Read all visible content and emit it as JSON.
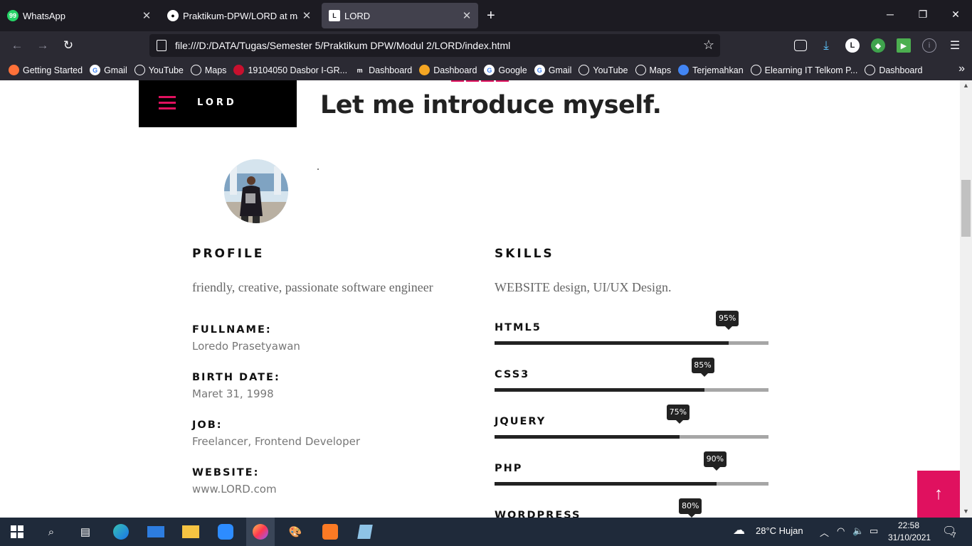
{
  "tabs": [
    {
      "label": "WhatsApp",
      "icon": "whatsapp-icon",
      "badge": "99+",
      "color": "#25d366"
    },
    {
      "label": "Praktikum-DPW/LORD at main",
      "icon": "github-icon"
    },
    {
      "label": "LORD",
      "icon": "lord-favicon"
    }
  ],
  "address": {
    "url": "file:///D:/DATA/Tugas/Semester 5/Praktikum DPW/Modul 2/LORD/index.html"
  },
  "toolbar": {
    "account_initial": "L"
  },
  "bookmarks": [
    {
      "label": "Getting Started",
      "icon": "firefox-icon"
    },
    {
      "label": "Gmail",
      "icon": "google-icon"
    },
    {
      "label": "YouTube",
      "icon": "globe-icon"
    },
    {
      "label": "Maps",
      "icon": "globe-icon"
    },
    {
      "label": "19104050 Dasbor I-GR...",
      "icon": "igracias-icon"
    },
    {
      "label": "Dashboard",
      "icon": "moodle-icon"
    },
    {
      "label": "Dashboard",
      "icon": "dashboard-icon"
    },
    {
      "label": "Google",
      "icon": "google-icon"
    },
    {
      "label": "Gmail",
      "icon": "google-icon"
    },
    {
      "label": "YouTube",
      "icon": "globe-icon"
    },
    {
      "label": "Maps",
      "icon": "globe-icon"
    },
    {
      "label": "Terjemahkan",
      "icon": "translate-icon"
    },
    {
      "label": "Elearning IT Telkom P...",
      "icon": "globe-icon"
    },
    {
      "label": "Dashboard",
      "icon": "globe-icon"
    }
  ],
  "site": {
    "logo": "LORD",
    "headline": "Let me introduce myself."
  },
  "profile": {
    "heading": "PROFILE",
    "summary": "friendly, creative, passionate software engineer",
    "fields": [
      {
        "label": "FULLNAME:",
        "value": "Loredo Prasetyawan"
      },
      {
        "label": "BIRTH DATE:",
        "value": "Maret 31, 1998"
      },
      {
        "label": "JOB:",
        "value": "Freelancer, Frontend Developer"
      },
      {
        "label": "WEBSITE:",
        "value": "www.LORD.com"
      }
    ]
  },
  "skills": {
    "heading": "SKILLS",
    "summary": "WEBSITE design, UI/UX Design.",
    "items": [
      {
        "name": "HTML5",
        "percent": 95,
        "label": "95%"
      },
      {
        "name": "CSS3",
        "percent": 85,
        "label": "85%"
      },
      {
        "name": "JQUERY",
        "percent": 75,
        "label": "75%"
      },
      {
        "name": "PHP",
        "percent": 90,
        "label": "90%"
      },
      {
        "name": "WORDPRESS",
        "percent": 80,
        "label": "80%"
      }
    ]
  },
  "colors": {
    "accent": "#e0115f",
    "chrome_dark": "#1c1b22",
    "chrome": "#2b2a33"
  },
  "taskbar": {
    "weather": "28°C  Hujan",
    "time": "22:58",
    "date": "31/10/2021",
    "notifications": "7"
  }
}
